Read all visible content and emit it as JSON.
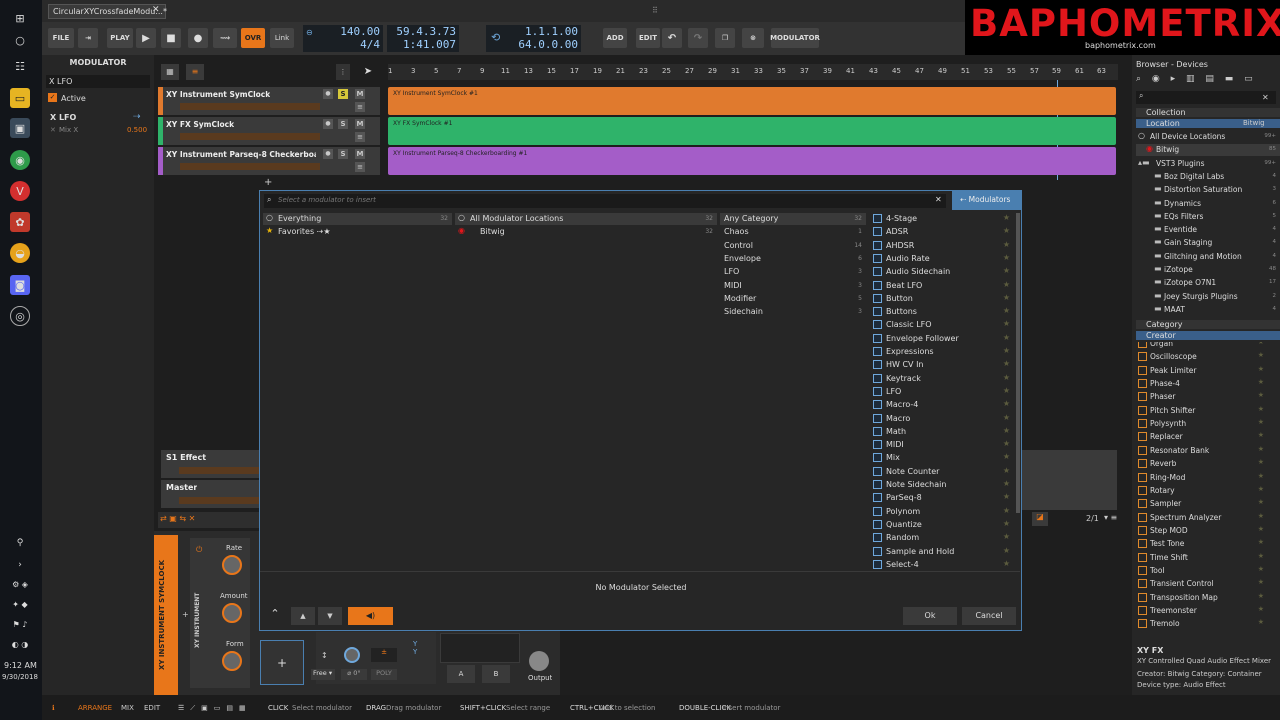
{
  "window": {
    "doc_tab": "CircularXYCrossfadeModu...*"
  },
  "transport": {
    "file": "FILE",
    "play_label": "PLAY",
    "ovr": "OVR",
    "link": "Link",
    "tempo": "140.00",
    "signature": "4/4",
    "position": "59.4.3.73",
    "time": "1:41.007",
    "loop_start": "1.1.1.00",
    "loop_len": "64.0.0.00",
    "add": "ADD",
    "edit": "EDIT",
    "modulator": "MODULATOR"
  },
  "brand": {
    "title": "BAPHOMETRIX",
    "url": "baphometrix.com"
  },
  "inspector": {
    "header": "MODULATOR",
    "name": "X LFO",
    "active": "Active",
    "mod_name": "X LFO",
    "mod_target": "Mix X",
    "mod_value": "0.500"
  },
  "timeline": {
    "ruler": [
      "1",
      "3",
      "5",
      "7",
      "9",
      "11",
      "13",
      "15",
      "17",
      "19",
      "21",
      "23",
      "25",
      "27",
      "29",
      "31",
      "33",
      "35",
      "37",
      "39",
      "41",
      "43",
      "45",
      "47",
      "49",
      "51",
      "53",
      "55",
      "57",
      "59",
      "61",
      "63"
    ]
  },
  "tracks": [
    {
      "name": "XY Instrument SymClock",
      "clip": "XY Instrument SymClock #1",
      "color": "#e07a2e"
    },
    {
      "name": "XY FX SymClock",
      "clip": "XY FX SymClock #1",
      "color": "#2fb36a"
    },
    {
      "name": "XY Instrument Parseq-8 Checkerboarding",
      "clip": "XY Instrument Parseq-8 Checkerboarding #1",
      "color": "#a45dc8"
    }
  ],
  "track_buttons": {
    "solo": "S",
    "mute": "M"
  },
  "fx_tracks": {
    "effect": "S1 Effect",
    "master": "Master"
  },
  "dialog": {
    "search_placeholder": "Select a modulator to insert",
    "tab": "Modulators",
    "col1": {
      "items": [
        {
          "label": "Everything",
          "count": "32"
        },
        {
          "label": "Favorites",
          "count": ""
        }
      ]
    },
    "col2": {
      "items": [
        {
          "label": "All Modulator Locations",
          "count": "32"
        },
        {
          "label": "Bitwig",
          "count": "32"
        }
      ]
    },
    "col3": {
      "items": [
        {
          "label": "Any Category",
          "count": "32"
        },
        {
          "label": "Chaos",
          "count": "1"
        },
        {
          "label": "Control",
          "count": "14"
        },
        {
          "label": "Envelope",
          "count": "6"
        },
        {
          "label": "LFO",
          "count": "3"
        },
        {
          "label": "MIDI",
          "count": "3"
        },
        {
          "label": "Modifier",
          "count": "5"
        },
        {
          "label": "Sidechain",
          "count": "3"
        }
      ]
    },
    "modulators": [
      "4-Stage",
      "ADSR",
      "AHDSR",
      "Audio Rate",
      "Audio Sidechain",
      "Beat LFO",
      "Button",
      "Buttons",
      "Classic LFO",
      "Envelope Follower",
      "Expressions",
      "HW CV In",
      "Keytrack",
      "LFO",
      "Macro-4",
      "Macro",
      "Math",
      "MIDI",
      "Mix",
      "Note Counter",
      "Note Sidechain",
      "ParSeq-8",
      "Polynom",
      "Quantize",
      "Random",
      "Sample and Hold",
      "Select-4"
    ],
    "status": "No Modulator Selected",
    "ok": "Ok",
    "cancel": "Cancel"
  },
  "browser": {
    "title": "Browser - Devices",
    "collection": "Collection",
    "location": "Location",
    "location_sel": "Bitwig",
    "locations": [
      {
        "label": "All Device Locations",
        "count": "99+"
      },
      {
        "label": "Bitwig",
        "count": "85"
      },
      {
        "label": "VST3 Plugins",
        "count": "99+"
      },
      {
        "label": "Boz Digital Labs",
        "count": "4"
      },
      {
        "label": "Distortion Saturation",
        "count": "3"
      },
      {
        "label": "Dynamics",
        "count": "6"
      },
      {
        "label": "EQs Filters",
        "count": "5"
      },
      {
        "label": "Eventide",
        "count": "4"
      },
      {
        "label": "Gain Staging",
        "count": "4"
      },
      {
        "label": "Glitching and Motion",
        "count": "4"
      },
      {
        "label": "iZotope",
        "count": "48"
      },
      {
        "label": "iZotope O7N1",
        "count": "17"
      },
      {
        "label": "Joey Sturgis Plugins",
        "count": "2"
      },
      {
        "label": "MAAT",
        "count": "4"
      }
    ],
    "category": "Category",
    "creator": "Creator",
    "devices": [
      "Organ",
      "Oscilloscope",
      "Peak Limiter",
      "Phase-4",
      "Phaser",
      "Pitch Shifter",
      "Polysynth",
      "Replacer",
      "Resonator Bank",
      "Reverb",
      "Ring-Mod",
      "Rotary",
      "Sampler",
      "Spectrum Analyzer",
      "Step MOD",
      "Test Tone",
      "Time Shift",
      "Tool",
      "Transient Control",
      "Transposition Map",
      "Treemonster",
      "Tremolo"
    ],
    "info_title": "XY FX",
    "info_desc": "XY Controlled Quad Audio Effect Mixer",
    "info_creator": "Creator: Bitwig   Category: Container",
    "info_type": "Device type: Audio Effect"
  },
  "device": {
    "track_name": "XY INSTRUMENT SYMCLOCK",
    "device_name": "XY INSTRUMENT",
    "rate": "Rate",
    "amount": "Amount",
    "form": "Form",
    "free": "Free",
    "poly": "POLY",
    "a": "A",
    "b": "B",
    "output": "Output"
  },
  "arranger_page": "2/1",
  "status": {
    "arrange": "ARRANGE",
    "mix": "MIX",
    "edit": "EDIT",
    "hints": [
      {
        "key": "CLICK",
        "desc": "Select modulator"
      },
      {
        "key": "DRAG",
        "desc": "Drag modulator"
      },
      {
        "key": "SHIFT+CLICK",
        "desc": "Select range"
      },
      {
        "key": "CTRL+CLICK",
        "desc": "Add to selection"
      },
      {
        "key": "DOUBLE-CLICK",
        "desc": "Insert modulator"
      }
    ]
  },
  "clock": {
    "time": "9:12 AM",
    "date": "9/30/2018"
  }
}
